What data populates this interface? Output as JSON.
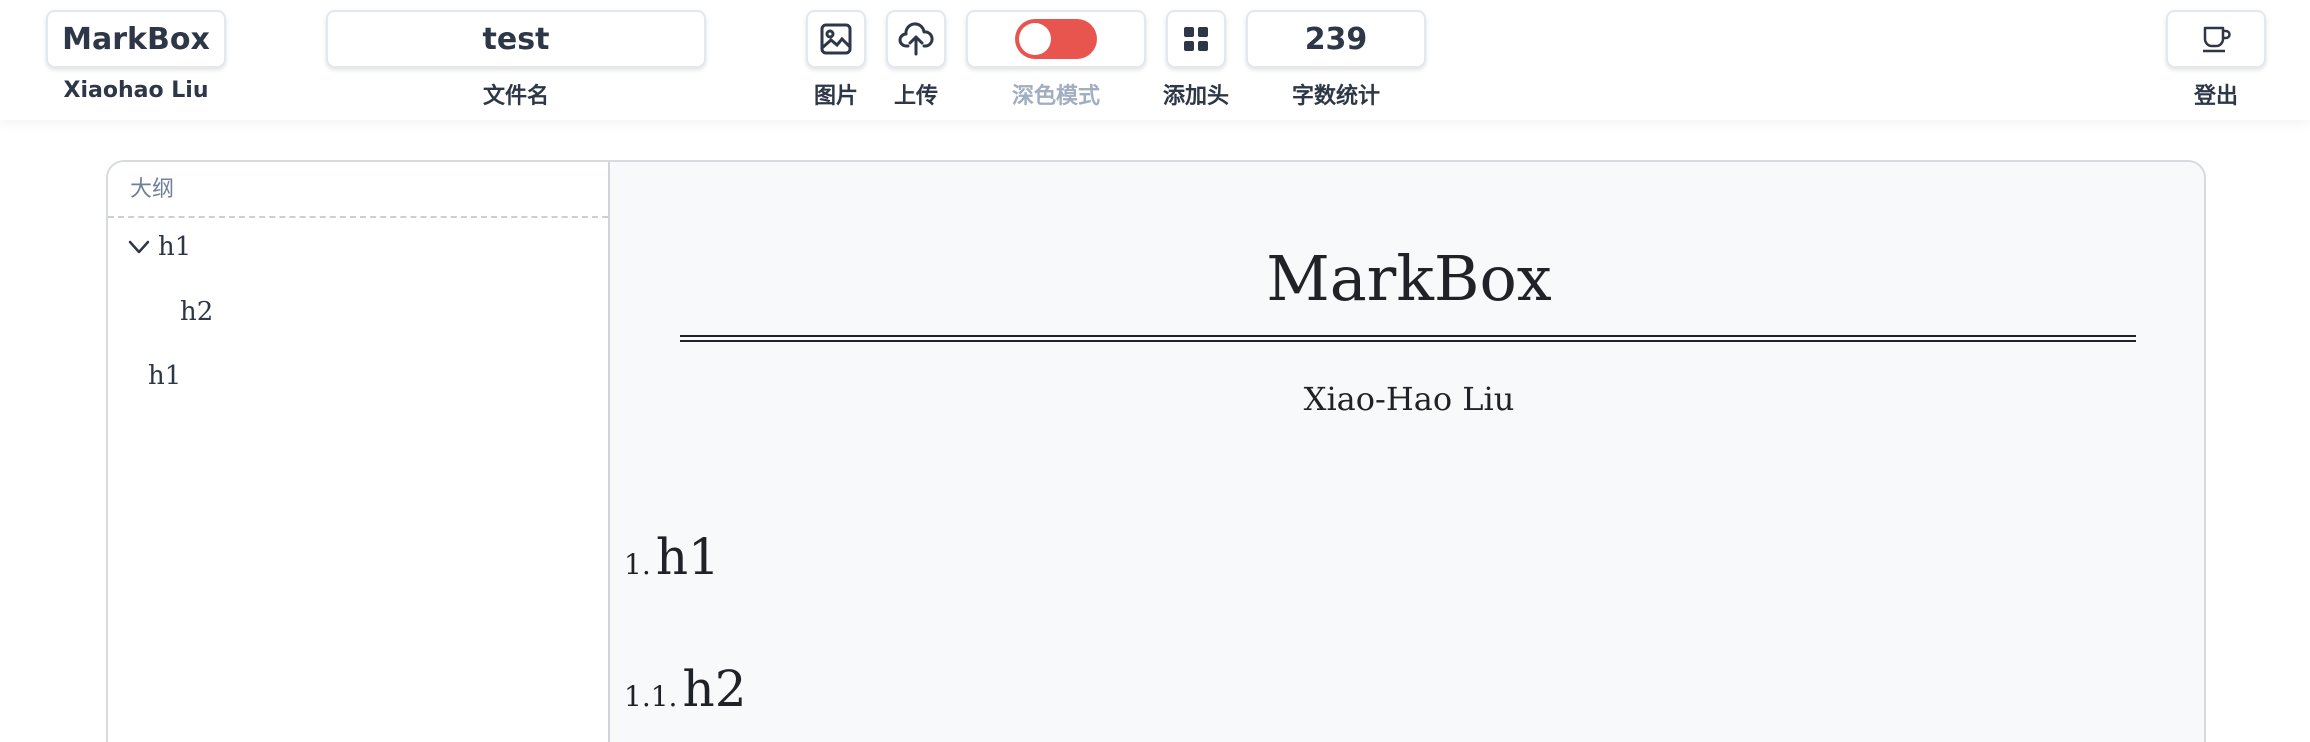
{
  "toolbar": {
    "brand": {
      "title": "MarkBox",
      "user": "Xiaohao Liu"
    },
    "filename": {
      "value": "test",
      "label": "文件名"
    },
    "image": {
      "icon": "image-icon",
      "label": "图片"
    },
    "upload": {
      "icon": "cloud-upload-icon",
      "label": "上传"
    },
    "dark_mode": {
      "label": "深色模式",
      "enabled": false,
      "accent": "#e8554e"
    },
    "add_header": {
      "icon": "grid-icon",
      "label": "添加头"
    },
    "word_count": {
      "value": "239",
      "label": "字数统计"
    },
    "logout": {
      "icon": "cup-icon",
      "label": "登出"
    }
  },
  "outline": {
    "title": "大纲",
    "items": [
      {
        "label": "h1",
        "level": 1,
        "expanded": true,
        "icon": "chevron-down-icon"
      },
      {
        "label": "h2",
        "level": 2
      },
      {
        "label": "h1",
        "level": 1
      }
    ]
  },
  "preview": {
    "title": "MarkBox",
    "author": "Xiao-Hao Liu",
    "headings": [
      {
        "number": "1.",
        "text": "h1"
      },
      {
        "number": "1.1.",
        "text": "h2"
      }
    ]
  }
}
